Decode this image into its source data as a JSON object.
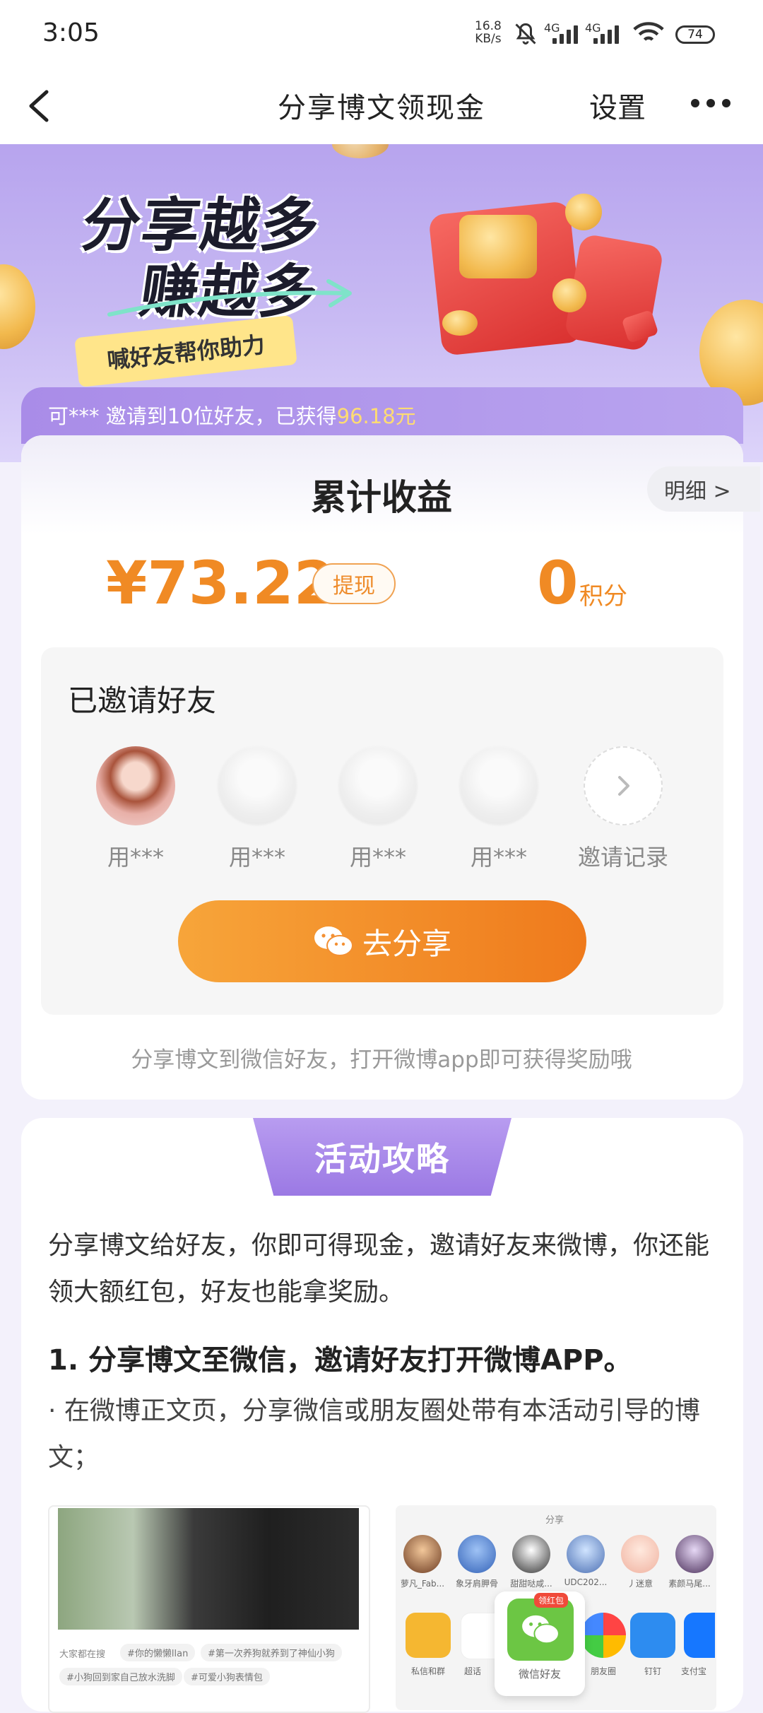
{
  "status_bar": {
    "time": "3:05",
    "net_speed_value": "16.8",
    "net_speed_unit": "KB/s",
    "signal1": "4G",
    "signal2": "4G",
    "battery": "74"
  },
  "nav": {
    "title": "分享博文领现金",
    "settings": "设置"
  },
  "banner": {
    "line1": "分享越多",
    "line2": "赚越多",
    "sub": "喊好友帮你助力"
  },
  "notice": {
    "prefix": "可*** 邀请到10位好友，已获得",
    "amount": "96.18元"
  },
  "earnings": {
    "title": "累计收益",
    "detail": "明细 >",
    "money": "¥73.22",
    "withdraw": "提现",
    "points_value": "0",
    "points_unit": "积分"
  },
  "invited": {
    "title": "已邀请好友",
    "friends": [
      "用***",
      "用***",
      "用***",
      "用***"
    ],
    "record": "邀请记录",
    "share_button": "去分享",
    "hint": "分享博文到微信好友，打开微博app即可获得奖励哦"
  },
  "strategy": {
    "tag": "活动攻略",
    "intro": "分享博文给好友，你即可得现金，邀请好友来微博，你还能领大额红包，好友也能拿奖励。",
    "step1_title": "1. 分享博文至微信，邀请好友打开微博APP。",
    "step1_bullet": "· 在微博正文页，分享微信或朋友圈处带有本活动引导的博文；"
  },
  "example1": {
    "search_hint": "大家都在搜",
    "chips": [
      "#你的懒懒llan",
      "#第一次养狗就养到了神仙小狗",
      "#小狗回到家自己放水洗脚",
      "#可爱小狗表情包"
    ]
  },
  "example2": {
    "header": "分享",
    "contacts": [
      "萝凡_Fab...",
      "象牙肩胛骨",
      "甜甜哒咸...",
      "UDC202...",
      "丿迷意",
      "素颜马尾..."
    ],
    "apps": [
      "私信和群",
      "超话",
      "朋友圈",
      "钉钉",
      "支付宝"
    ],
    "wechat_badge": "领红包",
    "wechat_label": "微信好友"
  },
  "colors": {
    "accent_orange": "#f08a24",
    "purple": "#a98ce8",
    "gold": "#ffdc72"
  }
}
